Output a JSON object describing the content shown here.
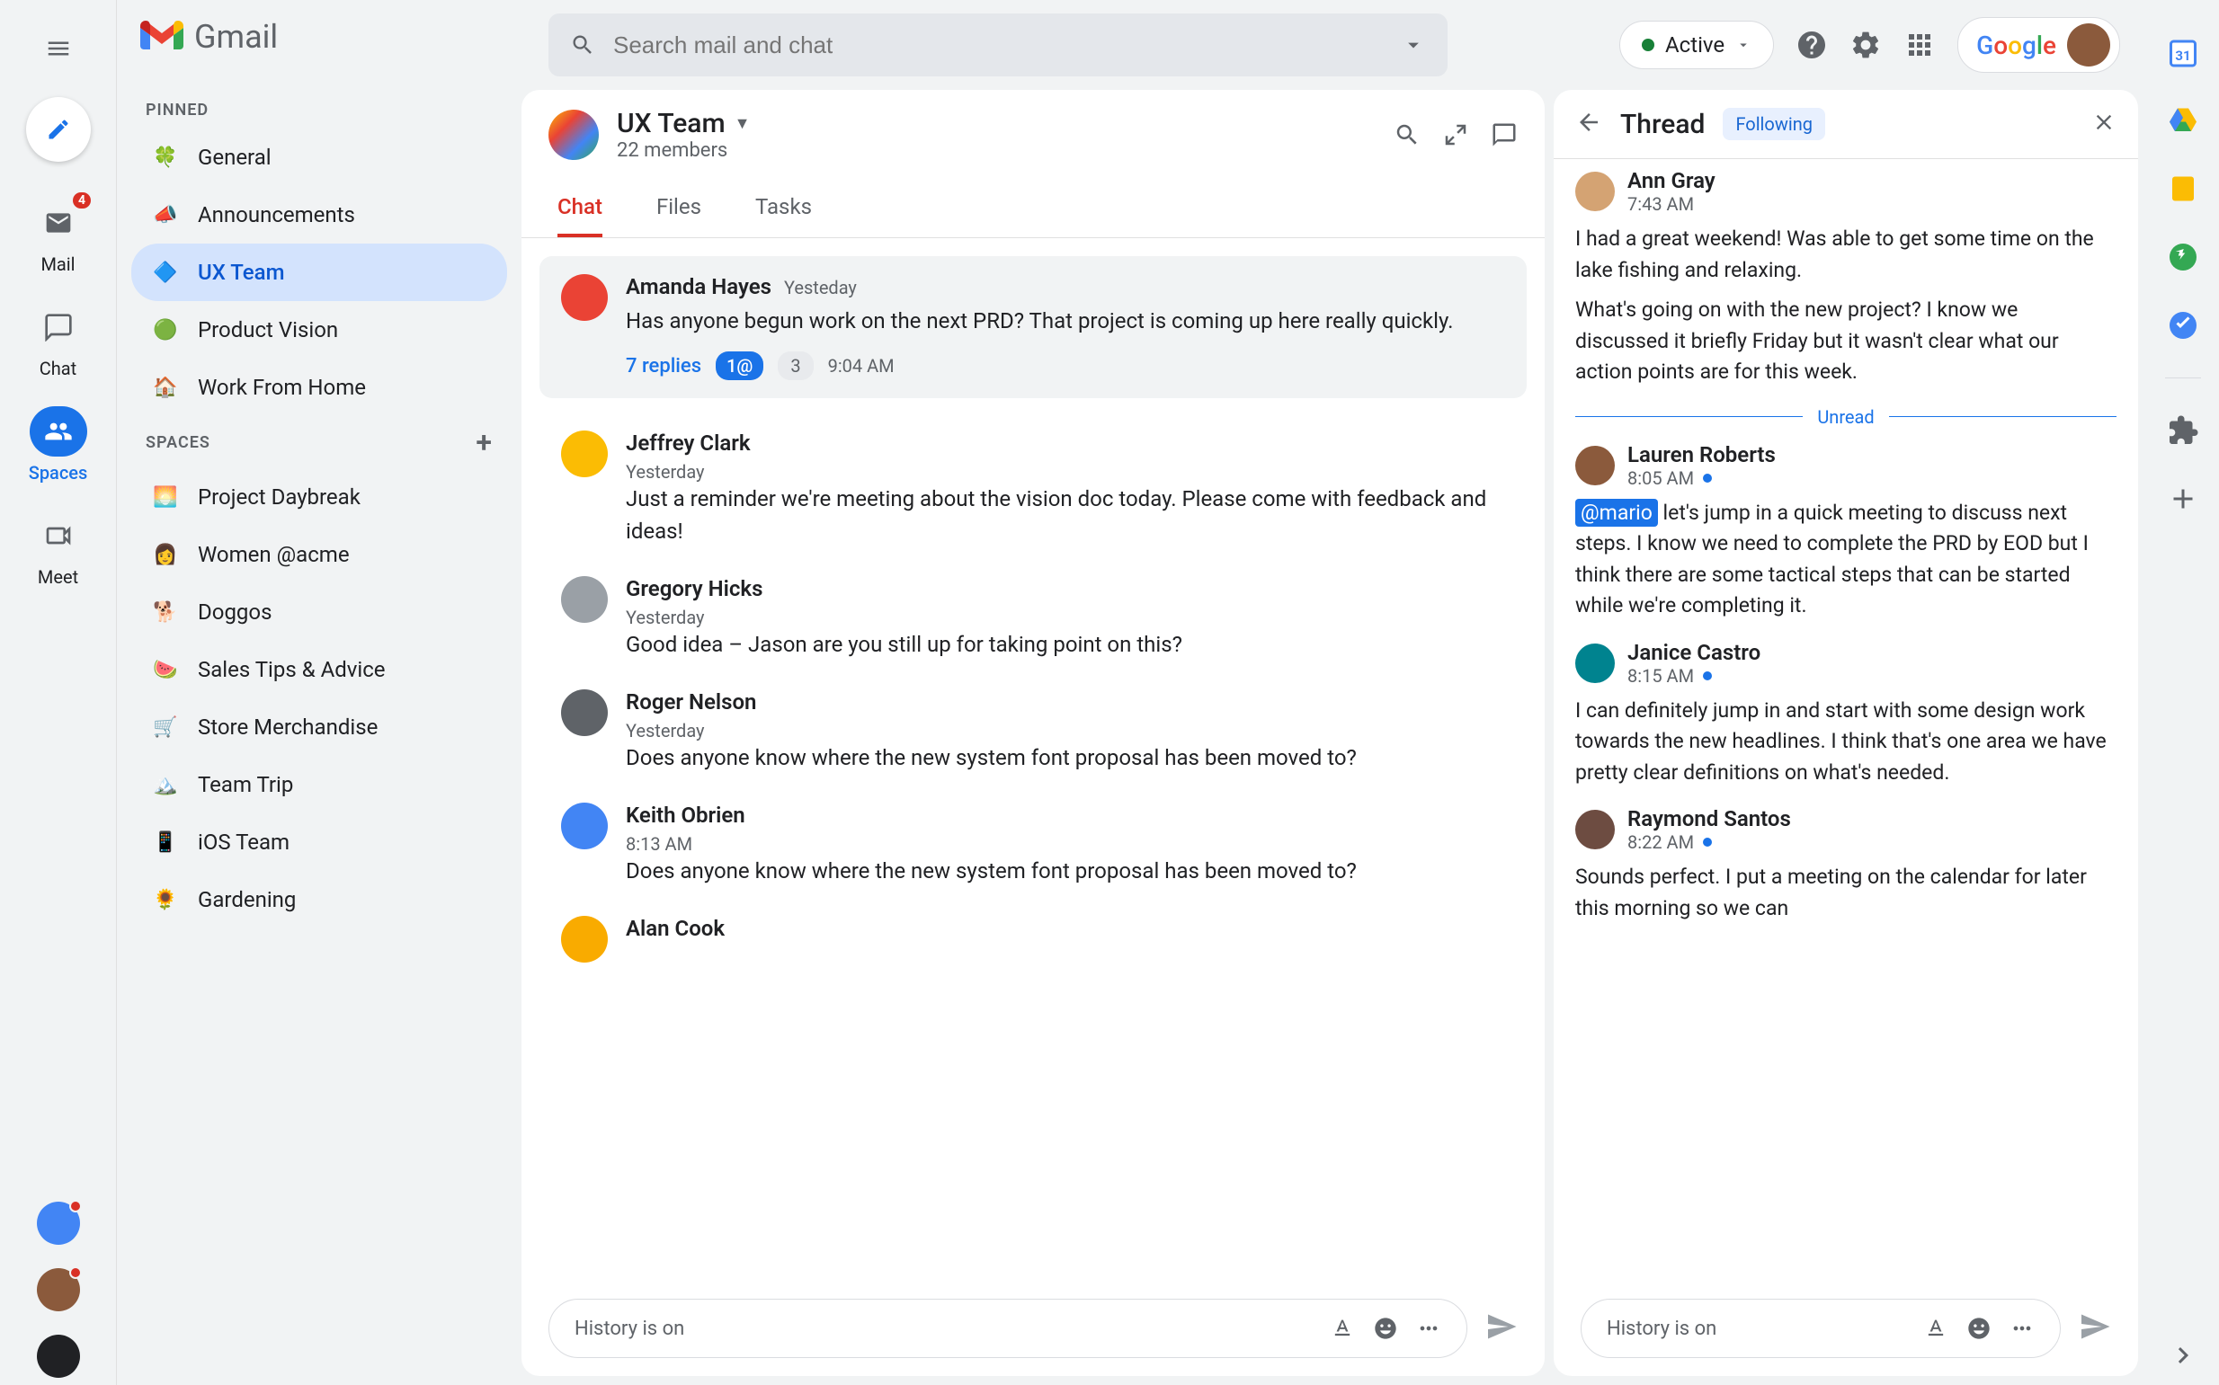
{
  "nav": {
    "mail": {
      "label": "Mail",
      "badge": "4"
    },
    "chat": {
      "label": "Chat"
    },
    "spaces": {
      "label": "Spaces"
    },
    "meet": {
      "label": "Meet"
    }
  },
  "header": {
    "logo": "Gmail",
    "search_placeholder": "Search mail and chat",
    "status": "Active",
    "google": "Google"
  },
  "sidebar": {
    "pinned_label": "PINNED",
    "spaces_label": "SPACES",
    "pinned": [
      {
        "icon": "🍀",
        "label": "General"
      },
      {
        "icon": "📣",
        "label": "Announcements"
      },
      {
        "icon": "🔷",
        "label": "UX Team",
        "active": true
      },
      {
        "icon": "🟢",
        "label": "Product Vision"
      },
      {
        "icon": "🏠",
        "label": "Work From Home"
      }
    ],
    "spaces": [
      {
        "icon": "🌅",
        "label": "Project Daybreak"
      },
      {
        "icon": "👩",
        "label": "Women @acme"
      },
      {
        "icon": "🐕",
        "label": "Doggos"
      },
      {
        "icon": "🍉",
        "label": "Sales Tips & Advice"
      },
      {
        "icon": "🛒",
        "label": "Store Merchandise"
      },
      {
        "icon": "🏔️",
        "label": "Team Trip"
      },
      {
        "icon": "📱",
        "label": "iOS Team"
      },
      {
        "icon": "🌻",
        "label": "Gardening"
      }
    ]
  },
  "space": {
    "name": "UX Team",
    "members": "22 members",
    "tabs": {
      "chat": "Chat",
      "files": "Files",
      "tasks": "Tasks"
    }
  },
  "messages": [
    {
      "author": "Amanda Hayes",
      "time": "Yesteday",
      "text": "Has anyone begun work on the next PRD? That project is coming up here really quickly.",
      "highlighted": true,
      "replies": "7 replies",
      "mention_pill": "1@",
      "count_pill": "3",
      "reply_time": "9:04 AM"
    },
    {
      "author": "Jeffrey Clark",
      "time": "Yesterday",
      "text": "Just a reminder we're meeting about the vision doc today. Please come with feedback and ideas!"
    },
    {
      "author": "Gregory Hicks",
      "time": "Yesterday",
      "text": "Good idea – Jason are you still up for taking point on this?"
    },
    {
      "author": "Roger Nelson",
      "time": "Yesterday",
      "text": "Does anyone know where the new system font proposal has been moved to?"
    },
    {
      "author": "Keith Obrien",
      "time": "8:13 AM",
      "text": "Does anyone know where the new system font proposal has been moved to?"
    },
    {
      "author": "Alan Cook",
      "time": "",
      "text": ""
    }
  ],
  "thread": {
    "title": "Thread",
    "following": "Following",
    "unread_label": "Unread",
    "messages": [
      {
        "author": "Ann Gray",
        "time": "7:43 AM",
        "text": "I had a great weekend! Was able to get some time on the lake fishing and relaxing.",
        "text2": "What's going on with the new project? I know we discussed it briefly Friday but it wasn't clear what our action points are for this week."
      },
      {
        "author": "Lauren Roberts",
        "time": "8:05 AM",
        "unread": true,
        "mention": "@mario",
        "text": " let's jump in a quick meeting to discuss next steps. I know we need to complete the PRD by EOD but I think there are some tactical steps that can be started while we're completing it."
      },
      {
        "author": "Janice Castro",
        "time": "8:15 AM",
        "unread": true,
        "text": "I can definitely jump in and start with some design work towards the new headlines. I think that's one area we have pretty clear definitions on what's needed."
      },
      {
        "author": "Raymond Santos",
        "time": "8:22 AM",
        "unread": true,
        "text": "Sounds perfect. I put a meeting on the calendar for later this morning so we can"
      }
    ]
  },
  "compose": {
    "placeholder": "History is on"
  }
}
